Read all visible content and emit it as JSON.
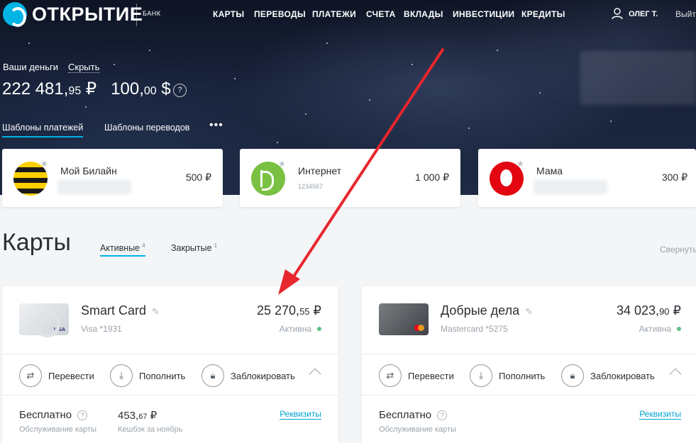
{
  "header": {
    "logo_text": "ОТКРЫТИЕ",
    "logo_sub": "БАНК",
    "nav": [
      "КАРТЫ",
      "ПЕРЕВОДЫ",
      "ПЛАТЕЖИ",
      "СЧЕТА",
      "ВКЛАДЫ",
      "ИНВЕСТИЦИИ",
      "КРЕДИТЫ"
    ],
    "user_name": "ОЛЕГ Т.",
    "logout": "Выйти"
  },
  "money": {
    "label": "Ваши деньги",
    "hide": "Скрыть",
    "rub_int": "222 481,",
    "rub_frac": "95",
    "rub_sign": "₽",
    "usd_int": "100,",
    "usd_frac": "00",
    "usd_sign": "$",
    "help": "?"
  },
  "templates": {
    "tabs": [
      "Шаблоны платежей",
      "Шаблоны переводов"
    ],
    "more": "•••",
    "items": [
      {
        "name": "Мой Билайн",
        "sub": "",
        "amount": "500 ₽",
        "icon": "beeline-logo-icon"
      },
      {
        "name": "Интернет",
        "sub": "1234567",
        "amount": "1 000 ₽",
        "icon": "internet-provider-icon"
      },
      {
        "name": "Мама",
        "sub": "",
        "amount": "300 ₽",
        "icon": "mts-logo-icon"
      }
    ]
  },
  "cards_section": {
    "title": "Карты",
    "tab_active": "Активные",
    "tab_active_count": "4",
    "tab_closed": "Закрытые",
    "tab_closed_count": "1",
    "collapse": "Свернуть"
  },
  "cards": [
    {
      "name": "Smart Card",
      "number": "Visa *1931",
      "amount_int": "25 270,",
      "amount_frac": "55",
      "currency": "₽",
      "status": "Активна",
      "actions": [
        "Перевести",
        "Пополнить",
        "Заблокировать"
      ],
      "fee_label": "Бесплатно",
      "fee_sub": "Обслуживание карты",
      "cashback_int": "453,",
      "cashback_frac": "67",
      "cashback_currency": "₽",
      "cashback_sub": "Кешбэк за ноябрь",
      "details": "Реквизиты"
    },
    {
      "name": "Добрые дела",
      "number": "Mastercard *5275",
      "amount_int": "34 023,",
      "amount_frac": "90",
      "currency": "₽",
      "status": "Активна",
      "actions": [
        "Перевести",
        "Пополнить",
        "Заблокировать"
      ],
      "fee_label": "Бесплатно",
      "fee_sub": "Обслуживание карты",
      "details": "Реквизиты"
    }
  ],
  "colors": {
    "accent": "#00b4e6",
    "annotation_arrow": "#e8262d",
    "status_active": "#55c27e"
  }
}
